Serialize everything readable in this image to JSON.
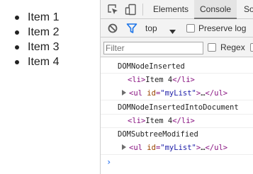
{
  "page": {
    "list_items": [
      "Item 1",
      "Item 2",
      "Item 3",
      "Item 4"
    ]
  },
  "devtools": {
    "tabs": [
      {
        "label": "Elements",
        "active": false
      },
      {
        "label": "Console",
        "active": true
      },
      {
        "label": "So",
        "active": false
      }
    ],
    "toolbar_icons": [
      "inspect-element-icon",
      "device-toggle-icon"
    ],
    "console_toolbar": {
      "context": "top",
      "preserve_log_label": "Preserve log",
      "preserve_log_checked": false
    },
    "filter": {
      "placeholder": "Filter",
      "regex_label": "Regex",
      "regex_checked": false
    },
    "messages": [
      {
        "kind": "text",
        "text": "DOMNodeInserted"
      },
      {
        "kind": "node",
        "open": "<li>",
        "content": "Item 4",
        "close": "</li>"
      },
      {
        "kind": "collapsed",
        "open_tag": "<ul",
        "attr_name": "id",
        "attr_eq": "=",
        "attr_value": "\"myList\"",
        "open_end": ">",
        "ellipsis": "…",
        "close": "</ul>"
      },
      {
        "kind": "text",
        "text": "DOMNodeInsertedIntoDocument"
      },
      {
        "kind": "node",
        "open": "<li>",
        "content": "Item 4",
        "close": "</li>"
      },
      {
        "kind": "text",
        "text": "DOMSubtreeModified"
      },
      {
        "kind": "collapsed",
        "open_tag": "<ul",
        "attr_name": "id",
        "attr_eq": "=",
        "attr_value": "\"myList\"",
        "open_end": ">",
        "ellipsis": "…",
        "close": "</ul>"
      }
    ],
    "prompt_symbol": "›",
    "accent_color": "#1a73e8"
  }
}
